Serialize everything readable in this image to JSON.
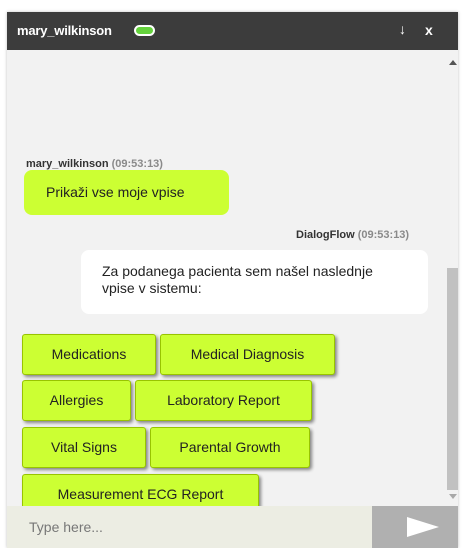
{
  "header": {
    "username": "mary_wilkinson",
    "status": "online",
    "minimize_glyph": "↓",
    "close_glyph": "x"
  },
  "messages": [
    {
      "sender": "mary_wilkinson",
      "time": "(09:53:13)",
      "text": "Prikaži vse moje vpise"
    },
    {
      "sender": "DialogFlow",
      "time": "(09:53:13)",
      "text": "Za podanega pacienta sem našel naslednje vpise v sistemu:"
    }
  ],
  "quick_replies": [
    "Medications",
    "Medical Diagnosis",
    "Allergies",
    "Laboratory Report",
    "Vital Signs",
    "Parental Growth",
    "Measurement ECG Report"
  ],
  "input": {
    "placeholder": "Type here...",
    "value": ""
  },
  "colors": {
    "header_bg": "#3c3c3c",
    "accent_green": "#ccff33",
    "status_green": "#64d23c",
    "send_button": "#b0b0b0"
  },
  "icons": {
    "status": "toggle-icon",
    "minimize": "arrow-down-icon",
    "close": "close-icon",
    "send": "send-arrow-icon"
  }
}
